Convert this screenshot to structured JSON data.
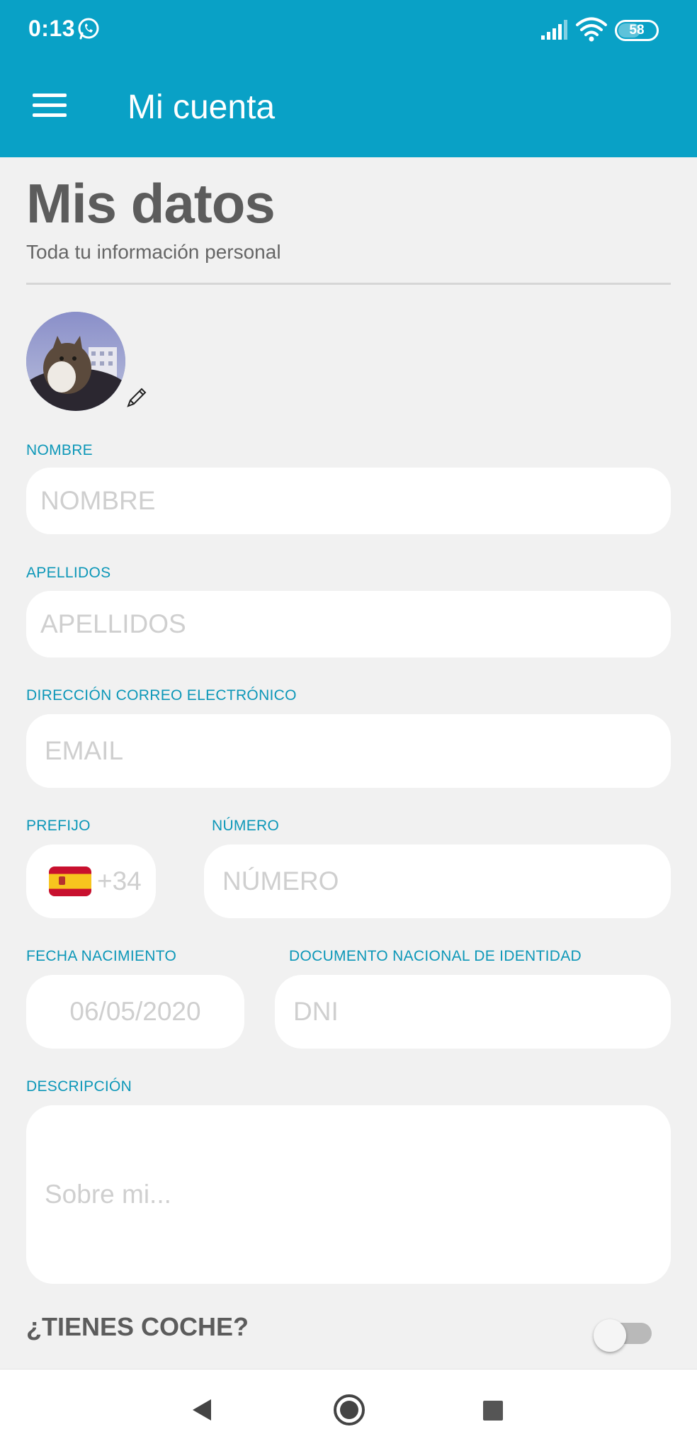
{
  "status_bar": {
    "time": "0:13",
    "battery": "58",
    "icons": [
      "whatsapp-icon",
      "signal-icon",
      "wifi-icon",
      "battery-icon"
    ]
  },
  "app_bar": {
    "title": "Mi cuenta",
    "menu_icon": "hamburger-menu-icon"
  },
  "header": {
    "title": "Mis datos",
    "subtitle": "Toda tu información personal"
  },
  "profile": {
    "avatar": "avatar-photo",
    "edit_icon": "pencil-icon"
  },
  "form": {
    "nombre": {
      "label": "NOMBRE",
      "placeholder": "NOMBRE",
      "value": ""
    },
    "apellidos": {
      "label": "APELLIDOS",
      "placeholder": "APELLIDOS",
      "value": ""
    },
    "email": {
      "label": "DIRECCIÓN CORREO ELECTRÓNICO",
      "placeholder": "EMAIL",
      "value": ""
    },
    "prefijo": {
      "label": "PREFIJO",
      "value": "+34",
      "flag": "spain-flag"
    },
    "numero": {
      "label": "NÚMERO",
      "placeholder": "NÚMERO",
      "value": ""
    },
    "fecha": {
      "label": "FECHA NACIMIENTO",
      "placeholder": "06/05/2020",
      "value": ""
    },
    "dni": {
      "label": "DOCUMENTO NACIONAL DE IDENTIDAD",
      "placeholder": "DNI",
      "value": ""
    },
    "descripcion": {
      "label": "DESCRIPCIÓN",
      "placeholder": "Sobre mi...",
      "value": ""
    }
  },
  "coche": {
    "title": "¿TIENES COCHE?",
    "enabled": false
  },
  "nav_bar": {
    "icons": [
      "back-icon",
      "home-icon",
      "recent-apps-icon"
    ]
  },
  "colors": {
    "primary": "#09a1c6",
    "label": "#0c97b8",
    "heading": "#5c5c5c",
    "background": "#f1f1f1"
  }
}
